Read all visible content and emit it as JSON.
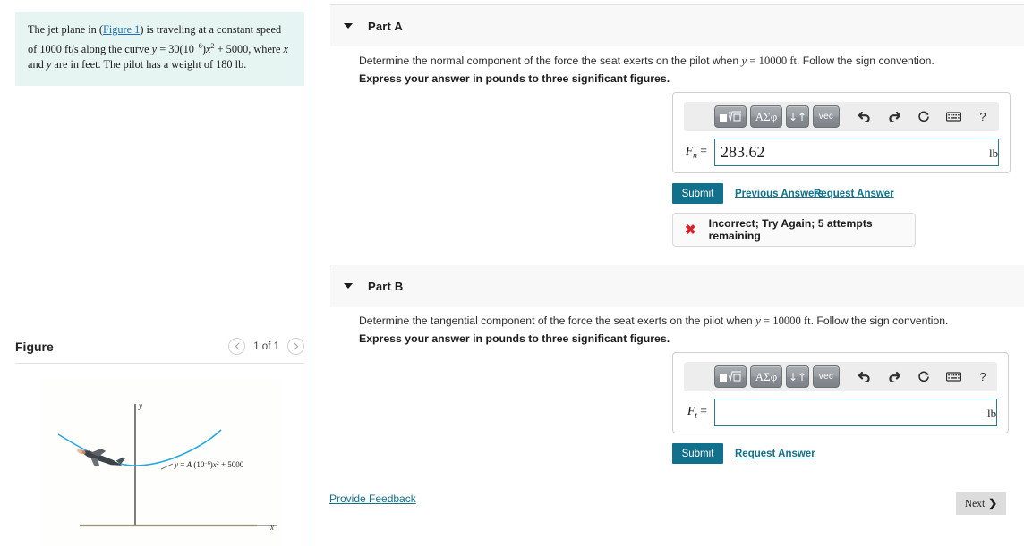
{
  "problem": {
    "prefix": "The jet plane in (",
    "figure_link": "Figure 1",
    "line1_rest": ") is traveling at a constant speed of",
    "speed": "1000 ft/s",
    "mid": " along the curve ",
    "equation": "y = 30(10−6)x² + 5000",
    "tail1": ", where x",
    "line3": "and y are in feet. The pilot has a weight of 180 lb."
  },
  "figure": {
    "title": "Figure",
    "prev_icon": "chevron-left-icon",
    "next_icon": "chevron-right-icon",
    "counter": "1 of 1",
    "axis_y_label": "y",
    "axis_x_label": "x",
    "curve_label": "y = A (10–6)x2 + 5000"
  },
  "parts": [
    {
      "id": "a",
      "caret_icon": "caret-down-icon",
      "label": "Part A",
      "question": "Determine the normal component of the force the seat exerts on the pilot when ",
      "question_var": "y",
      "question_eq": " = 10000 ",
      "question_unit": "ft",
      "question_tail": ". Follow the sign convention.",
      "instruction": "Express your answer in pounds to three significant figures.",
      "var_label": "F",
      "var_sub": "n",
      "var_eq": " =",
      "value": "283.62",
      "placeholder": "",
      "unit": "lb",
      "submit_label": "Submit",
      "links": [
        "Previous Answers",
        "Request Answer"
      ],
      "feedback": {
        "icon": "x-mark-icon",
        "text": "Incorrect; Try Again; 5 attempts remaining"
      }
    },
    {
      "id": "b",
      "caret_icon": "caret-down-icon",
      "label": "Part B",
      "question": "Determine the tangential component of the force the seat exerts on the pilot when ",
      "question_var": "y",
      "question_eq": " = 10000 ",
      "question_unit": "ft",
      "question_tail": ". Follow the sign convention.",
      "instruction": "Express your answer in pounds to three significant figures.",
      "var_label": "F",
      "var_sub": "t",
      "var_eq": " =",
      "value": "",
      "placeholder": "",
      "unit": "lb",
      "submit_label": "Submit",
      "links": [
        "Request Answer"
      ],
      "feedback": null
    }
  ],
  "toolbar": {
    "buttons": [
      {
        "name": "template-root-button",
        "label": "■√□"
      },
      {
        "name": "greek-symbols-button",
        "label": "ΑΣφ"
      },
      {
        "name": "updown-arrows-button",
        "label": "↓↑"
      },
      {
        "name": "vector-button",
        "label": "vec"
      }
    ],
    "icons": [
      {
        "name": "undo-icon",
        "glyph": "↶"
      },
      {
        "name": "redo-icon",
        "glyph": "↷"
      },
      {
        "name": "reset-icon",
        "glyph": "↻"
      },
      {
        "name": "keyboard-icon",
        "glyph": "⌨"
      },
      {
        "name": "help-icon",
        "glyph": "?"
      }
    ]
  },
  "footer": {
    "provide_feedback": "Provide Feedback",
    "next_label": "Next",
    "next_icon": "chevron-right-icon"
  },
  "colors": {
    "accent": "#11718c",
    "problem_bg": "#e6f4f2",
    "error": "#d8232a",
    "curve": "#29a8df",
    "part_header_bg": "#f8f8f8"
  }
}
